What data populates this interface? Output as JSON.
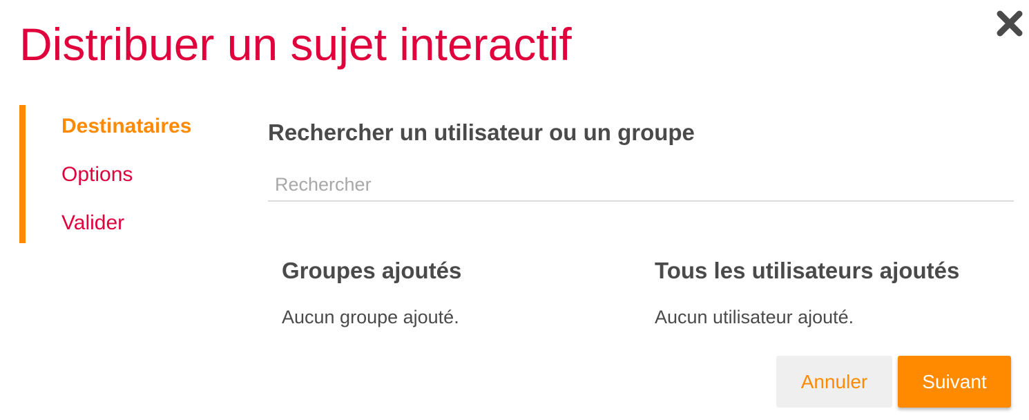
{
  "modal": {
    "title": "Distribuer un sujet interactif",
    "close_icon": "close-icon"
  },
  "steps": [
    {
      "label": "Destinataires",
      "active": true
    },
    {
      "label": "Options",
      "active": false
    },
    {
      "label": "Valider",
      "active": false
    }
  ],
  "search": {
    "heading": "Rechercher un utilisateur ou un groupe",
    "placeholder": "Rechercher",
    "value": ""
  },
  "groups": {
    "title": "Groupes ajoutés",
    "empty_text": "Aucun groupe ajouté."
  },
  "users": {
    "title": "Tous les utilisateurs ajoutés",
    "empty_text": "Aucun utilisateur ajouté."
  },
  "buttons": {
    "cancel_label": "Annuler",
    "next_label": "Suivant"
  },
  "colors": {
    "primary": "#e0003c",
    "accent": "#ff8a00",
    "text": "#4a4a4a"
  }
}
